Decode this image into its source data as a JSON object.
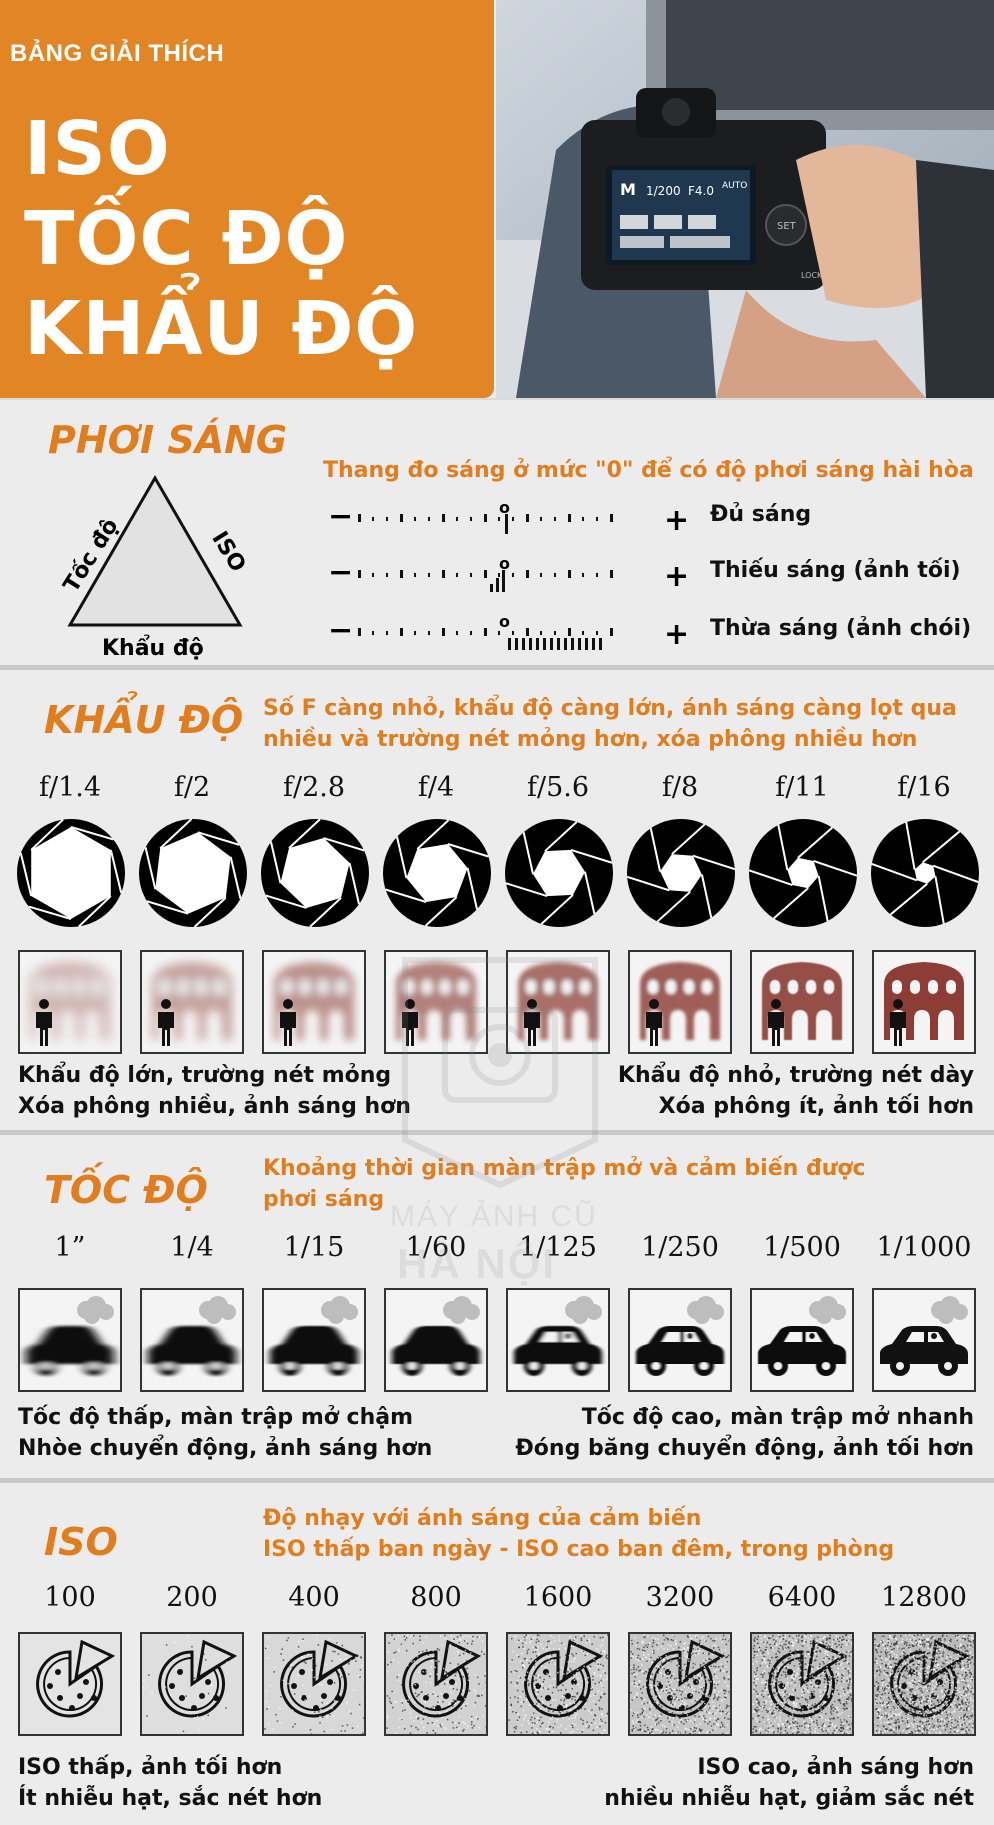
{
  "header": {
    "kicker": "BẢNG GIẢI THÍCH",
    "title_lines": [
      "ISO",
      "TỐC ĐỘ",
      "KHẨU ĐỘ"
    ]
  },
  "exposure": {
    "title": "PHƠI SÁNG",
    "triangle": {
      "left": "Tốc độ",
      "right": "ISO",
      "bottom": "Khẩu độ"
    },
    "meter_heading": "Thang đo sáng ở mức \"0\" để có độ phơi sáng hài hòa",
    "meter_rows": [
      {
        "label": "Đủ sáng",
        "zero_mark": "o",
        "minus": "−",
        "plus": "+"
      },
      {
        "label": "Thiếu sáng (ảnh tối)",
        "zero_mark": "o",
        "minus": "−",
        "plus": "+"
      },
      {
        "label": "Thừa sáng (ảnh chói)",
        "zero_mark": "o",
        "minus": "−",
        "plus": "+"
      }
    ]
  },
  "aperture": {
    "title": "KHẨU ĐỘ",
    "desc_lines": [
      "Số F càng nhỏ, khẩu độ càng lớn, ánh sáng càng lọt qua",
      "nhiều và trường nét mỏng hơn, xóa phông nhiều hơn"
    ],
    "stops": [
      "f/1.4",
      "f/2",
      "f/2.8",
      "f/4",
      "f/5.6",
      "f/8",
      "f/11",
      "f/16"
    ],
    "caption_left": [
      "Khẩu độ lớn, trường nét mỏng",
      "Xóa phông nhiều, ảnh sáng hơn"
    ],
    "caption_right": [
      "Khẩu độ nhỏ, trường nét dày",
      "Xóa phông ít, ảnh tối hơn"
    ]
  },
  "shutter": {
    "title": "TỐC ĐỘ",
    "desc_lines": [
      "Khoảng thời gian màn trập mở và cảm biến được",
      "phơi sáng"
    ],
    "speeds": [
      "1”",
      "1/4",
      "1/15",
      "1/60",
      "1/125",
      "1/250",
      "1/500",
      "1/1000"
    ],
    "caption_left": [
      "Tốc độ thấp, màn trập mở chậm",
      "Nhòe chuyển động, ảnh sáng hơn"
    ],
    "caption_right": [
      "Tốc độ cao, màn trập mở nhanh",
      "Đóng băng chuyển động, ảnh tối hơn"
    ]
  },
  "iso": {
    "title": "ISO",
    "desc_lines": [
      "Độ nhạy với ánh sáng của cảm biến",
      "ISO thấp ban ngày - ISO cao ban đêm, trong phòng"
    ],
    "values": [
      "100",
      "200",
      "400",
      "800",
      "1600",
      "3200",
      "6400",
      "12800"
    ],
    "caption_left": [
      "ISO thấp, ảnh tối hơn",
      "Ít nhiễu hạt, sắc nét hơn"
    ],
    "caption_right": [
      "ISO cao, ảnh sáng hơn",
      "nhiều nhiễu hạt, giảm sắc nét"
    ]
  },
  "camera_screen": {
    "mode": "M",
    "shutter": "1/200",
    "aperture": "F4.0",
    "wb": "AUTO",
    "button": "SET",
    "lock": "LOCK"
  },
  "watermark": {
    "line1": "MÁY ẢNH CŨ",
    "line2": "HÀ NỘI"
  },
  "colors": {
    "orange": "#e28524",
    "title_orange": "#e07d1e",
    "building_red": "#8b3a33",
    "panel_bg": "#ececec"
  }
}
